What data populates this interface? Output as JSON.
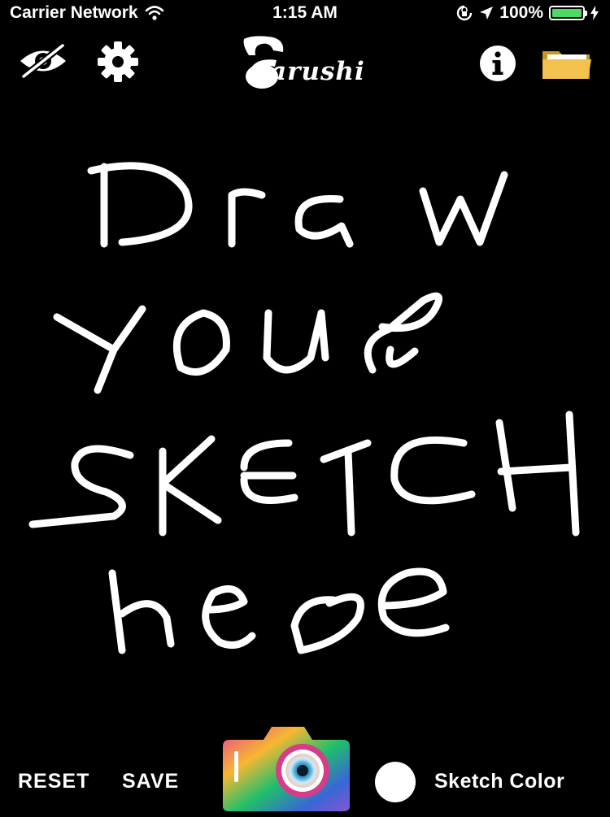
{
  "status_bar": {
    "carrier": "Carrier Network",
    "time": "1:15 AM",
    "battery_percent": "100%",
    "battery_level": 1.0,
    "battery_color": "#4cd964"
  },
  "toolbar": {
    "logo_text": "arushi",
    "icons": {
      "hide": "eye-slash-icon",
      "settings": "gear-icon",
      "info": "info-icon",
      "open": "folder-icon"
    },
    "folder_color": "#f2c14e"
  },
  "canvas": {
    "background": "#000000",
    "stroke_color": "#ffffff",
    "sketch_lines": [
      "Draw",
      "your",
      "SKETCH",
      "here"
    ]
  },
  "bottom_bar": {
    "reset_label": "RESET",
    "save_label": "SAVE",
    "camera_icon": "camera-icon",
    "sketch_color_label": "Sketch Color",
    "current_sketch_color": "#ffffff"
  }
}
